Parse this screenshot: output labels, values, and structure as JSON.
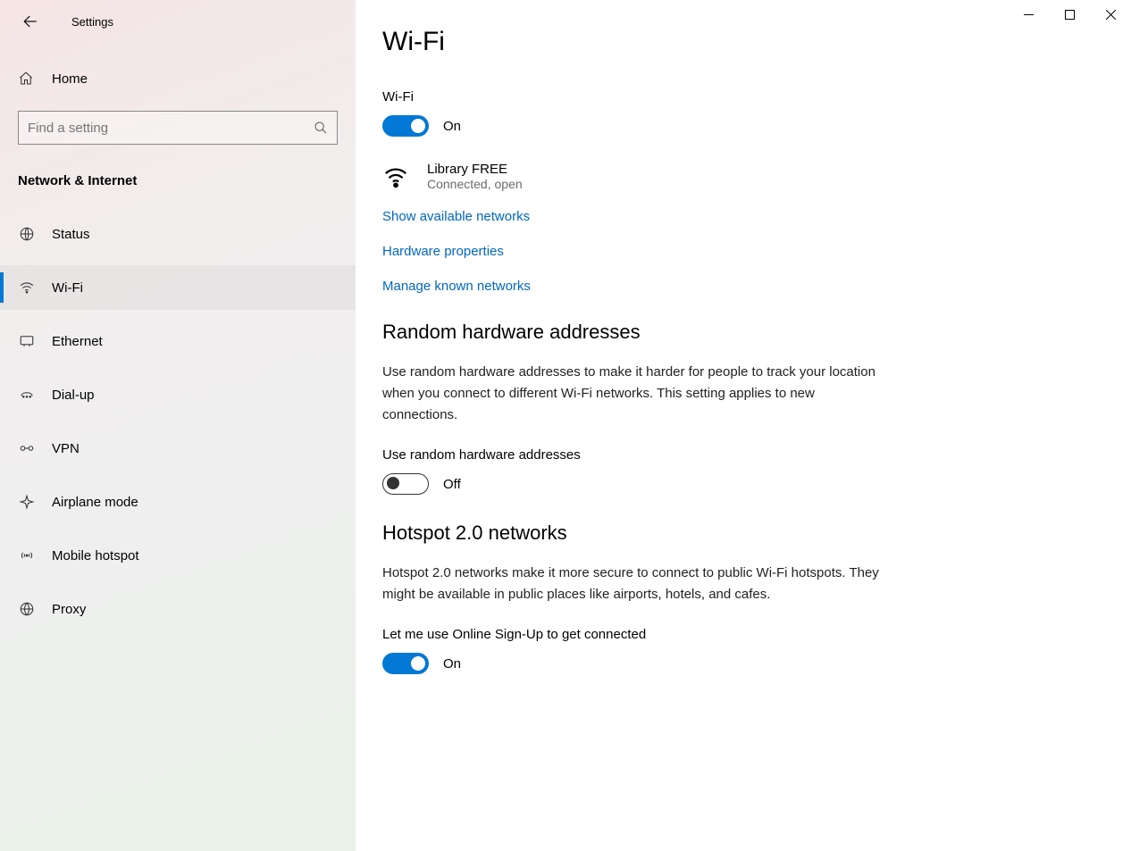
{
  "window": {
    "title": "Settings"
  },
  "sidebar": {
    "home": "Home",
    "search_placeholder": "Find a setting",
    "section": "Network & Internet",
    "items": [
      {
        "label": "Status"
      },
      {
        "label": "Wi-Fi"
      },
      {
        "label": "Ethernet"
      },
      {
        "label": "Dial-up"
      },
      {
        "label": "VPN"
      },
      {
        "label": "Airplane mode"
      },
      {
        "label": "Mobile hotspot"
      },
      {
        "label": "Proxy"
      }
    ]
  },
  "main": {
    "title": "Wi-Fi",
    "wifi_label": "Wi-Fi",
    "wifi_toggle_state": "On",
    "network": {
      "name": "Library FREE",
      "status": "Connected, open"
    },
    "links": {
      "show_networks": "Show available networks",
      "hardware_props": "Hardware properties",
      "manage_known": "Manage known networks"
    },
    "random": {
      "heading": "Random hardware addresses",
      "body": "Use random hardware addresses to make it harder for people to track your location when you connect to different Wi-Fi networks. This setting applies to new connections.",
      "toggle_label": "Use random hardware addresses",
      "toggle_state": "Off"
    },
    "hotspot": {
      "heading": "Hotspot 2.0 networks",
      "body": "Hotspot 2.0 networks make it more secure to connect to public Wi-Fi hotspots. They might be available in public places like airports, hotels, and cafes.",
      "toggle_label": "Let me use Online Sign-Up to get connected",
      "toggle_state": "On"
    }
  }
}
